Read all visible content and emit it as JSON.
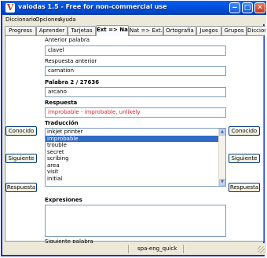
{
  "window": {
    "title": "valodas 1.5 - Free for non-commercial use",
    "icon": "V"
  },
  "menu": [
    "Diccionario",
    "Opciones",
    "Ayuda"
  ],
  "tabs": [
    "Progress",
    "Aprender",
    "Tarjetas",
    "Ext => Nat",
    "Nat => Ext.",
    "Ortografía",
    "Juegos",
    "Grupos",
    "Diccionar"
  ],
  "active_tab": "Ext => Nat",
  "form": {
    "anterior_label": "Anterior palabra",
    "anterior_value": "clavel",
    "respuesta_anterior_label": "Respuesta anterior",
    "respuesta_anterior_value": "carnation",
    "palabra_label": "Palabra 2 / 27636",
    "palabra_value": "arcano",
    "respuesta_label": "Respuesta",
    "respuesta_value": "improbable - improbable, unlikely",
    "respuesta_color": "#e0242e",
    "traduccion_label": "Traducción",
    "traduccion_items": [
      "inkjet printer",
      "improbable",
      "trouble",
      "secret",
      "scribing",
      "area",
      "visit",
      "initial"
    ],
    "traduccion_selected": "improbable",
    "expresiones_label": "Expresiones",
    "siguiente_palabra_label": "Siguiente palabra"
  },
  "buttons": {
    "conocido": "Conocido",
    "siguiente": "Siguiente",
    "respuesta": "Respuesta"
  },
  "status": {
    "dictionary": "spa-eng_quick"
  },
  "colors": {
    "titlebar": "#0054e3",
    "selection": "#316ac5",
    "window_bg": "#ece9d8"
  }
}
